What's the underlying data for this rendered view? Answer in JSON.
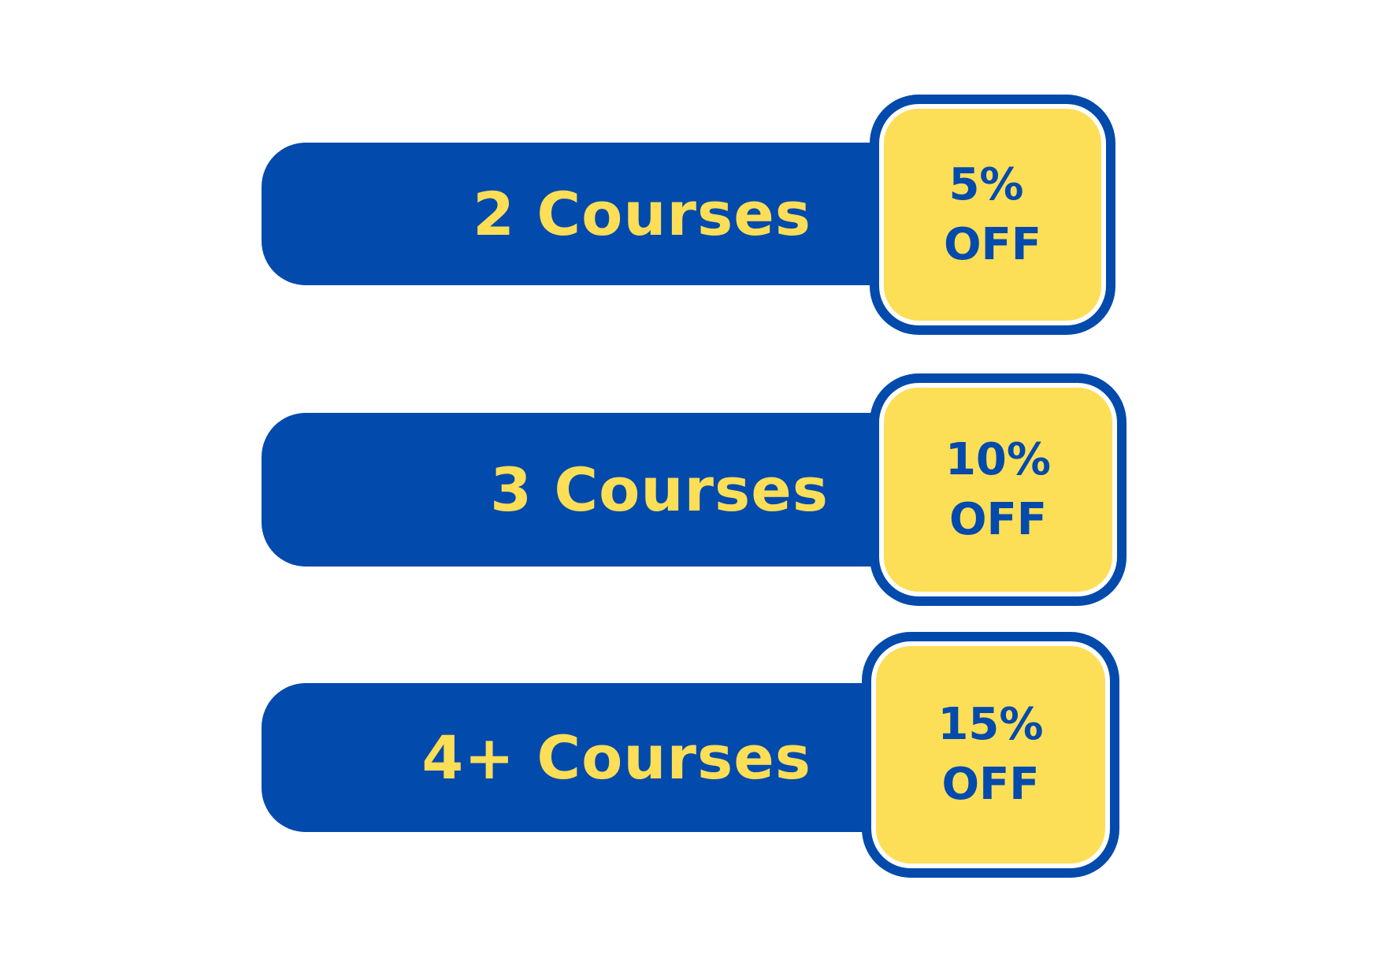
{
  "colors": {
    "banner": "#024aac",
    "badge_fill": "#fdde57",
    "badge_border": "#024aac",
    "label_text": "#fdde57",
    "badge_text": "#024aac"
  },
  "tiers": [
    {
      "courses": "2 Courses",
      "percent": "5%",
      "off": "OFF"
    },
    {
      "courses": "3 Courses",
      "percent": "10%",
      "off": "OFF"
    },
    {
      "courses": "4+ Courses",
      "percent": "15%",
      "off": "OFF"
    }
  ]
}
